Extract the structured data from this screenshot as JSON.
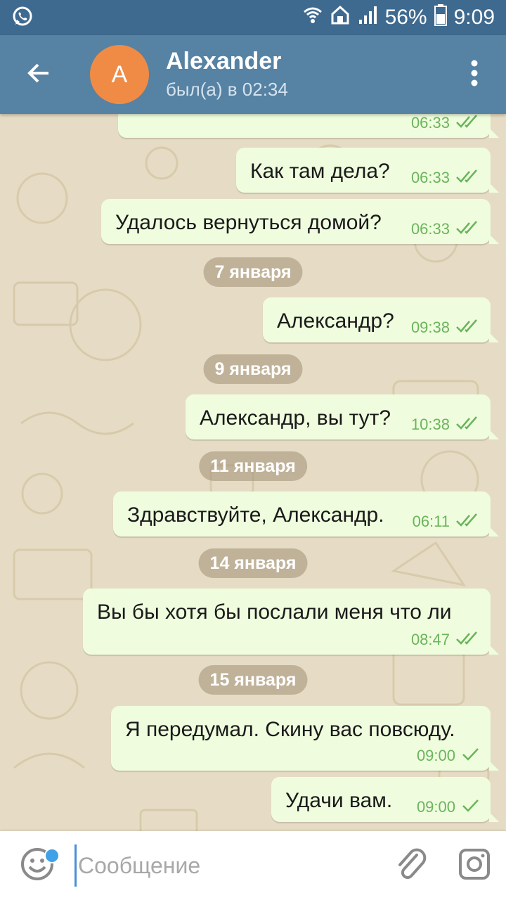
{
  "status_bar": {
    "app_icon": "whatsapp-icon",
    "battery_percent": "56%",
    "time": "9:09",
    "icons": [
      "wifi-icon",
      "home-icon",
      "signal-icon",
      "battery-icon"
    ]
  },
  "header": {
    "avatar_letter": "A",
    "name": "Alexander",
    "status": "был(а) в 02:34",
    "back_icon": "arrow-left-icon",
    "menu_icon": "more-vertical-icon"
  },
  "colors": {
    "header": "#5682a3",
    "status_bar": "#3f6a8f",
    "avatar": "#f08b45",
    "bubble_out": "#effdde",
    "time_green": "#6bb45c",
    "chat_bg": "#e6dcc5"
  },
  "messages": [
    {
      "text": "",
      "time": "06:33",
      "status": "read"
    },
    {
      "text": "Как там дела?",
      "time": "06:33",
      "status": "read"
    },
    {
      "text": "Удалось вернуться домой?",
      "time": "06:33",
      "status": "read"
    },
    {
      "date": "7 января"
    },
    {
      "text": "Александр?",
      "time": "09:38",
      "status": "read"
    },
    {
      "date": "9 января"
    },
    {
      "text": "Александр, вы тут?",
      "time": "10:38",
      "status": "read"
    },
    {
      "date": "11 января"
    },
    {
      "text": "Здравствуйте, Александр.",
      "time": "06:11",
      "status": "read"
    },
    {
      "date": "14 января"
    },
    {
      "text": "Вы бы хотя бы послали меня что ли",
      "time": "08:47",
      "status": "read"
    },
    {
      "date": "15 января"
    },
    {
      "text": "Я передумал. Скину вас повсюду.",
      "time": "09:00",
      "status": "sent"
    },
    {
      "text": "Удачи вам.",
      "time": "09:00",
      "status": "sent"
    }
  ],
  "input": {
    "placeholder": "Сообщение",
    "value": "",
    "emoji_icon": "smile-icon",
    "attach_icon": "paperclip-icon",
    "camera_icon": "camera-icon"
  }
}
